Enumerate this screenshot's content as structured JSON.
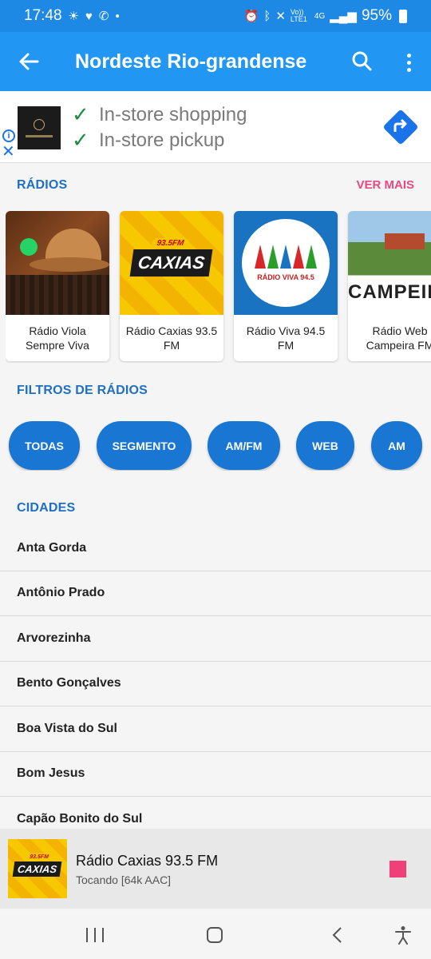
{
  "status_bar": {
    "time": "17:48",
    "left_icons": [
      "sun-icon",
      "heart-icon",
      "whatsapp-icon",
      "dot-icon"
    ],
    "right_icons": [
      "alarm-icon",
      "bluetooth-icon",
      "mute-icon",
      "volte-icon",
      "4g-icon",
      "signal-icon"
    ],
    "volte": "Vo)) LTE1",
    "network": "4G",
    "battery": "95%"
  },
  "app_bar": {
    "title": "Nordeste Rio-grandense",
    "color": "#2196f3"
  },
  "ad": {
    "line1": "In-store shopping",
    "line2": "In-store pickup"
  },
  "radios_section": {
    "title": "RÁDIOS",
    "see_more": "VER MAIS",
    "items": [
      {
        "name": "Rádio Viola Sempre Viva"
      },
      {
        "name": "Rádio Caxias 93.5 FM",
        "logo_text": "CAXIAS",
        "logo_badge": "93.5FM"
      },
      {
        "name": "Rádio Viva 94.5 FM",
        "logo_text": "RÁDIO VIVA 94.5"
      },
      {
        "name": "Rádio Web Campeira FM",
        "logo_text": "CAMPEIRA"
      }
    ]
  },
  "filters_section": {
    "title": "FILTROS DE RÁDIOS",
    "chips": [
      "TODAS",
      "SEGMENTO",
      "AM/FM",
      "WEB",
      "AM"
    ]
  },
  "cities_section": {
    "title": "CIDADES",
    "items": [
      "Anta Gorda",
      "Antônio Prado",
      "Arvorezinha",
      "Bento Gonçalves",
      "Boa Vista do Sul",
      "Bom Jesus",
      "Capão Bonito do Sul"
    ]
  },
  "player": {
    "title": "Rádio Caxias 93.5 FM",
    "status": "Tocando [64k AAC]",
    "logo_text": "CAXIAS",
    "logo_badge": "93.5FM",
    "stop_color": "#f0407a"
  },
  "colors": {
    "primary": "#2196f3",
    "section_title": "#1e6fc5",
    "accent": "#e84a7f",
    "chip": "#1976d2"
  }
}
